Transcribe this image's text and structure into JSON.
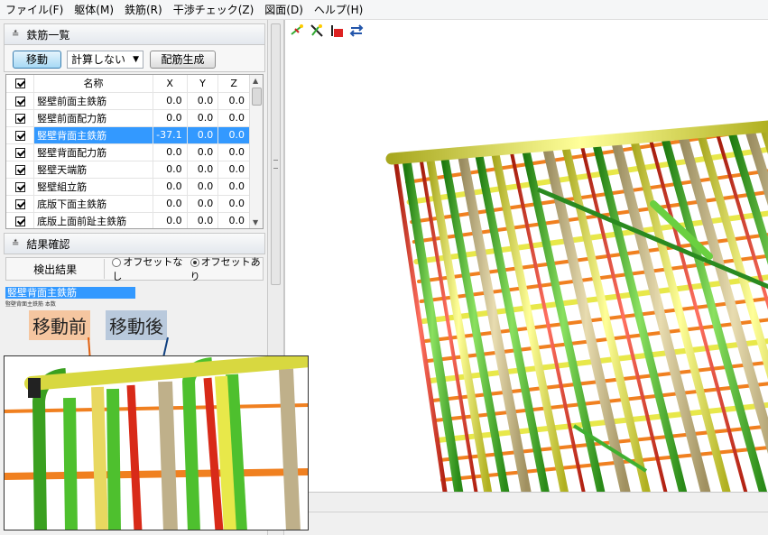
{
  "menu": [
    "ファイル(F)",
    "躯体(M)",
    "鉄筋(R)",
    "干渉チェック(Z)",
    "図面(D)",
    "ヘルプ(H)"
  ],
  "rebar_panel": {
    "header": "鉄筋一覧",
    "move_button": "移動",
    "calc_select": "計算しない",
    "generate_button": "配筋生成",
    "columns": [
      "名称",
      "X",
      "Y",
      "Z"
    ],
    "rows": [
      {
        "name": "竪壁前面主鉄筋",
        "x": "0.0",
        "y": "0.0",
        "z": "0.0",
        "selected": false
      },
      {
        "name": "竪壁前面配力筋",
        "x": "0.0",
        "y": "0.0",
        "z": "0.0",
        "selected": false
      },
      {
        "name": "竪壁背面主鉄筋",
        "x": "-37.1",
        "y": "0.0",
        "z": "0.0",
        "selected": true
      },
      {
        "name": "竪壁背面配力筋",
        "x": "0.0",
        "y": "0.0",
        "z": "0.0",
        "selected": false
      },
      {
        "name": "竪壁天端筋",
        "x": "0.0",
        "y": "0.0",
        "z": "0.0",
        "selected": false
      },
      {
        "name": "竪壁組立筋",
        "x": "0.0",
        "y": "0.0",
        "z": "0.0",
        "selected": false
      },
      {
        "name": "底版下面主鉄筋",
        "x": "0.0",
        "y": "0.0",
        "z": "0.0",
        "selected": false
      },
      {
        "name": "底版上面前趾主鉄筋",
        "x": "0.0",
        "y": "0.0",
        "z": "0.0",
        "selected": false
      }
    ]
  },
  "result_panel": {
    "header": "結果確認",
    "detect_label": "検出結果",
    "option_no_offset": "オフセットなし",
    "option_offset": "オフセットあり",
    "selected_option": "オフセットあり"
  },
  "selected_rebar_text": "竪壁背面主鉄筋",
  "small_text": "竪壁背面主鉄筋 本数",
  "annotations": {
    "before": "移動前",
    "after": "移動後"
  },
  "colors": {
    "rebar_green": "#4ec02e",
    "rebar_yellow": "#e8e84a",
    "rebar_red": "#e03020",
    "rebar_orange": "#f08020",
    "rebar_moved": "#c8b88a",
    "selection": "#3399ff"
  },
  "icons": [
    "add-rebar-icon",
    "delete-rebar-icon",
    "color-rebar-icon",
    "swap-rebar-icon"
  ]
}
